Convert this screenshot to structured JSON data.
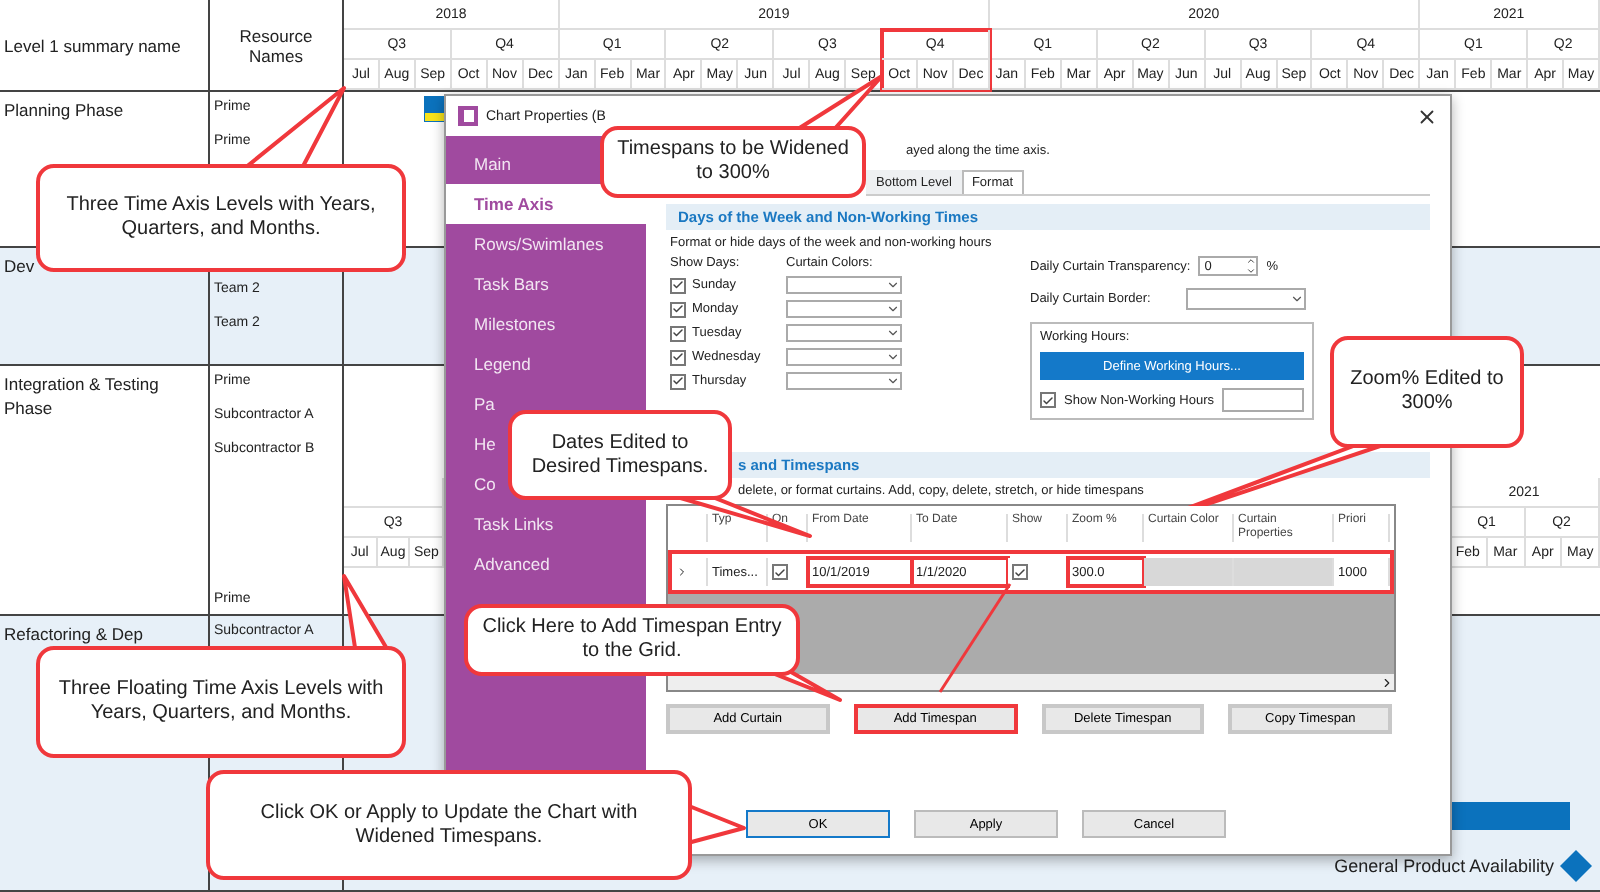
{
  "gantt": {
    "columns": [
      "Level 1 summary name",
      "Resource Names"
    ],
    "timeline": [
      {
        "label": "2018",
        "quarters": [
          {
            "label": "Q3",
            "highlighted": false,
            "months": [
              "Jul",
              "Aug",
              "Sep"
            ]
          },
          {
            "label": "Q4",
            "highlighted": false,
            "months": [
              "Oct",
              "Nov",
              "Dec"
            ]
          }
        ]
      },
      {
        "label": "2019",
        "quarters": [
          {
            "label": "Q1",
            "highlighted": false,
            "months": [
              "Jan",
              "Feb",
              "Mar"
            ]
          },
          {
            "label": "Q2",
            "highlighted": false,
            "months": [
              "Apr",
              "May",
              "Jun"
            ]
          },
          {
            "label": "Q3",
            "highlighted": false,
            "months": [
              "Jul",
              "Aug",
              "Sep"
            ]
          },
          {
            "label": "Q4",
            "highlighted": true,
            "months": [
              "Oct",
              "Nov",
              "Dec"
            ]
          }
        ]
      },
      {
        "label": "2020",
        "quarters": [
          {
            "label": "Q1",
            "highlighted": false,
            "months": [
              "Jan",
              "Feb",
              "Mar"
            ]
          },
          {
            "label": "Q2",
            "highlighted": false,
            "months": [
              "Apr",
              "May",
              "Jun"
            ]
          },
          {
            "label": "Q3",
            "highlighted": false,
            "months": [
              "Jul",
              "Aug",
              "Sep"
            ]
          },
          {
            "label": "Q4",
            "highlighted": false,
            "months": [
              "Oct",
              "Nov",
              "Dec"
            ]
          }
        ]
      },
      {
        "label": "2021",
        "quarters": [
          {
            "label": "Q1",
            "highlighted": false,
            "months": [
              "Jan",
              "Feb",
              "Mar"
            ]
          },
          {
            "label": "Q2",
            "highlighted": false,
            "months": [
              "Apr",
              "May"
            ]
          }
        ]
      }
    ],
    "phases": [
      {
        "name": "Planning Phase",
        "resources": [
          "Prime",
          "Prime"
        ]
      },
      {
        "name": "Dev",
        "resources": [
          "Team 2",
          "Team 2"
        ]
      },
      {
        "name": "Integration & Testing Phase",
        "resources": [
          "Prime",
          "Subcontractor A",
          "Subcontractor B",
          "Prime"
        ]
      },
      {
        "name": "Refactoring & Dep",
        "resources": [
          "Subcontractor A"
        ]
      }
    ],
    "floating_axis": {
      "left": {
        "quarter": "Q3",
        "months": [
          "Jul",
          "Aug",
          "Sep"
        ]
      },
      "right": {
        "year": "2021",
        "quarters": [
          "Q1",
          "Q2"
        ],
        "months": [
          "Feb",
          "Mar",
          "Apr",
          "May"
        ]
      }
    },
    "milestone": {
      "label": "General Product Availability"
    }
  },
  "dialog": {
    "title": "Chart Properties (B",
    "nav": [
      {
        "label": "Main",
        "selected": false
      },
      {
        "label": "Time Axis",
        "selected": true
      },
      {
        "label": "Rows/Swimlanes",
        "selected": false
      },
      {
        "label": "Task Bars",
        "selected": false
      },
      {
        "label": "Milestones",
        "selected": false
      },
      {
        "label": "Legend",
        "selected": false
      },
      {
        "label": "Pa",
        "selected": false
      },
      {
        "label": "He",
        "selected": false
      },
      {
        "label": "Co",
        "selected": false
      },
      {
        "label": "Task Links",
        "selected": false
      },
      {
        "label": "Advanced",
        "selected": false
      }
    ],
    "description": "ayed along the time axis.",
    "tabs": [
      {
        "label": "Bottom Level",
        "selected": false
      },
      {
        "label": "Format",
        "selected": true
      }
    ],
    "days_section": {
      "title": "Days of the Week and Non-Working Times",
      "hint": "Format or hide days of the week and non-working hours",
      "show_days_label": "Show Days:",
      "curtain_colors_label": "Curtain Colors:",
      "days": [
        {
          "label": "Sunday",
          "checked": true
        },
        {
          "label": "Monday",
          "checked": true
        },
        {
          "label": "Tuesday",
          "checked": true
        },
        {
          "label": "Wednesday",
          "checked": true
        },
        {
          "label": "Thursday",
          "checked": true
        }
      ],
      "transparency": {
        "label": "Daily Curtain Transparency:",
        "value": "0",
        "unit": "%"
      },
      "border": {
        "label": "Daily Curtain Border:"
      },
      "working_hours": {
        "label": "Working Hours:",
        "button": "Define Working Hours...",
        "show_non_working": {
          "label": "Show Non-Working Hours",
          "checked": true
        }
      }
    },
    "timespans_section": {
      "title": "s and Timespans",
      "hint": "delete, or format curtains.  Add, copy, delete, stretch, or hide timespans",
      "columns": [
        {
          "label": "Typ",
          "highlighted": false
        },
        {
          "label": "On",
          "highlighted": false
        },
        {
          "label": "From Date",
          "highlighted": true
        },
        {
          "label": "To Date",
          "highlighted": true
        },
        {
          "label": "Show",
          "highlighted": false
        },
        {
          "label": "Zoom %",
          "highlighted": true
        },
        {
          "label": "Curtain Color",
          "highlighted": false
        },
        {
          "label": "Curtain Properties",
          "highlighted": false
        },
        {
          "label": "Priori",
          "highlighted": false
        }
      ],
      "rows": [
        {
          "type": "Times...",
          "on": true,
          "from": "10/1/2019",
          "to": "1/1/2020",
          "show": true,
          "zoom": "300.0",
          "priority": "1000",
          "highlighted": true
        }
      ],
      "buttons": [
        {
          "label": "Add Curtain",
          "highlighted": false
        },
        {
          "label": "Add Timespan",
          "highlighted": true
        },
        {
          "label": "Delete Timespan",
          "highlighted": false
        },
        {
          "label": "Copy Timespan",
          "highlighted": false
        }
      ]
    },
    "footer_buttons": [
      {
        "label": "OK",
        "default": true
      },
      {
        "label": "Apply",
        "default": false
      },
      {
        "label": "Cancel",
        "default": false
      }
    ]
  },
  "callouts": [
    "Three Time Axis Levels with Years, Quarters, and Months.",
    "Timespans to be Widened to 300%",
    "Zoom% Edited to 300%",
    "Dates Edited to Desired Timespans.",
    "Click Here to Add Timespan Entry to the Grid.",
    "Three Floating Time Axis Levels with Years, Quarters, and Months.",
    "Click OK or Apply to Update the Chart with Widened Timespans."
  ]
}
